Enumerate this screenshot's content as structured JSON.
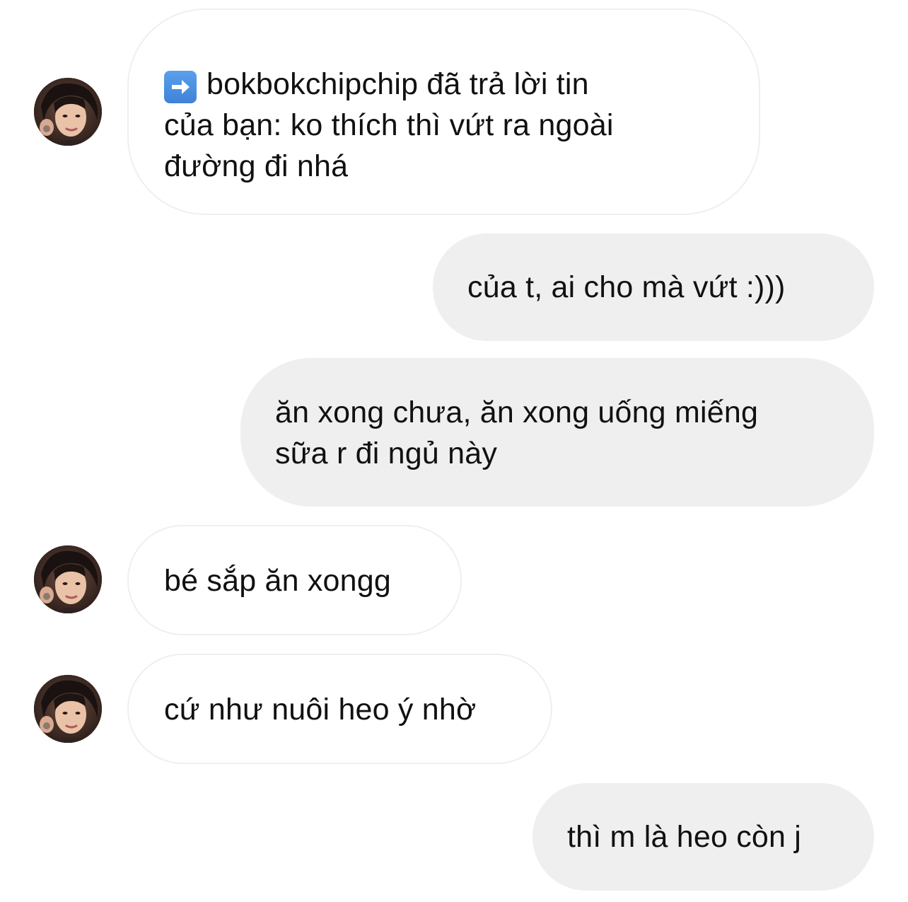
{
  "messages": [
    {
      "side": "in",
      "text": "bokbokchipchip đã trả lời tin\ncủa bạn: ko thích thì vứt ra ngoài\nđường đi nhá",
      "reply_icon": "right-arrow-emoji-icon"
    },
    {
      "side": "out",
      "text": "của t, ai cho mà vứt :)))"
    },
    {
      "side": "out",
      "text": "ăn xong chưa, ăn xong uống miếng\nsữa r đi ngủ này"
    },
    {
      "side": "in",
      "text": "bé sắp ăn xongg"
    },
    {
      "side": "in",
      "text": "cứ như nuôi heo ý nhờ"
    },
    {
      "side": "out",
      "text": "thì m là heo còn j"
    }
  ],
  "colors": {
    "incoming_bubble_bg": "#ffffff",
    "incoming_bubble_border": "#efefef",
    "outgoing_bubble_bg": "#efefef",
    "text": "#111111"
  }
}
